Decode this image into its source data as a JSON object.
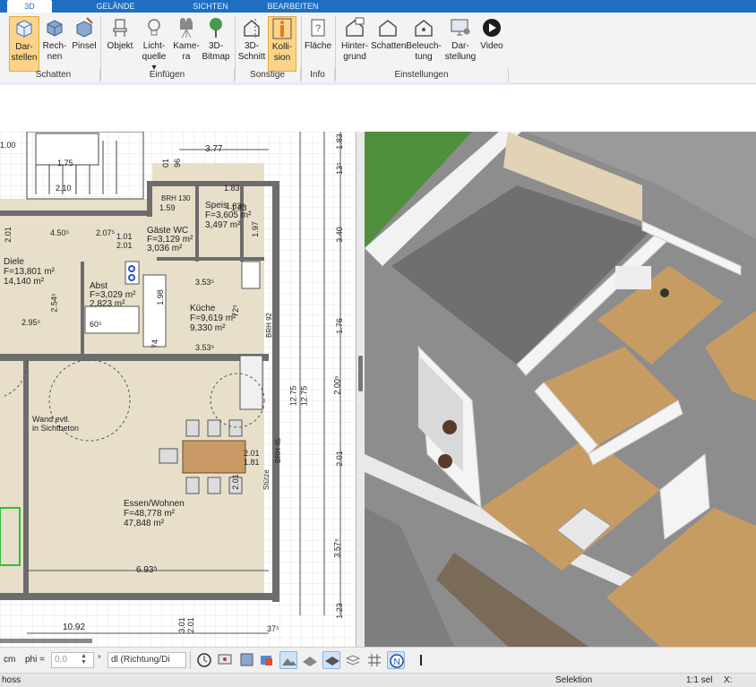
{
  "tabs": [
    {
      "label": "3D"
    },
    {
      "label": "GELÄNDE"
    },
    {
      "label": "SICHTEN"
    },
    {
      "label": "BEARBEITEN"
    }
  ],
  "ribbon": {
    "buttons": [
      {
        "line1": "Dar-",
        "line2": "stellen",
        "icon": "render-icon",
        "selected": true
      },
      {
        "line1": "Rech-",
        "line2": "nen",
        "icon": "calculate-icon",
        "selected": false
      },
      {
        "line1": "Pinsel",
        "line2": "",
        "icon": "brush-icon",
        "selected": false
      },
      {
        "line1": "Objekt",
        "line2": "",
        "icon": "chair-icon",
        "selected": false
      },
      {
        "line1": "Licht-",
        "line2": "quelle ▾",
        "icon": "lightbulb-icon",
        "selected": false
      },
      {
        "line1": "Kame-",
        "line2": "ra",
        "icon": "camera-icon",
        "selected": false
      },
      {
        "line1": "3D-",
        "line2": "Bitmap",
        "icon": "tree-icon",
        "selected": false
      },
      {
        "line1": "3D-",
        "line2": "Schnitt",
        "icon": "section-icon",
        "selected": false
      },
      {
        "line1": "Kolli-",
        "line2": "sion",
        "icon": "collision-person-icon",
        "selected": true
      },
      {
        "line1": "Fläche",
        "line2": "",
        "icon": "area-icon",
        "selected": false
      },
      {
        "line1": "Hinter-",
        "line2": "grund",
        "icon": "house-background-icon",
        "selected": false
      },
      {
        "line1": "Schatten",
        "line2": "",
        "icon": "house-shadow-icon",
        "selected": false
      },
      {
        "line1": "Beleuch-",
        "line2": "tung",
        "icon": "house-light-icon",
        "selected": false
      },
      {
        "line1": "Dar-",
        "line2": "stellung",
        "icon": "monitor-settings-icon",
        "selected": false
      },
      {
        "line1": "Video",
        "line2": "",
        "icon": "video-play-icon",
        "selected": false
      }
    ],
    "groups": [
      {
        "label": "Schatten"
      },
      {
        "label": "Einfügen"
      },
      {
        "label": "Sonstige"
      },
      {
        "label": "Info"
      },
      {
        "label": "Einstellungen"
      }
    ]
  },
  "plan": {
    "dims_top": [
      "3.77",
      "96",
      "01",
      "1.83",
      "1.83⁵",
      "1.75",
      "2.10",
      "1.00"
    ],
    "dims_right": [
      "1.83",
      "13⁵",
      "3.40",
      "1.76",
      "2.00⁵",
      "12.75",
      "12.75",
      "2.01",
      "3.57⁵",
      "1.23"
    ],
    "dims_bottom": [
      "10.92",
      "6.93⁵",
      "3.01",
      "2.01",
      "37⁵"
    ],
    "rooms": [
      {
        "name": "Diele",
        "line2": "F=13,801 m²",
        "line3": "14,140 m²"
      },
      {
        "name": "Abst",
        "line2": "F=3,029 m²",
        "line3": "2,823 m²"
      },
      {
        "name": "Gäste WC",
        "line2": "F=3,129 m²",
        "line3": "3,036 m²"
      },
      {
        "name": "Speis",
        "line2": "F=3,605 m²",
        "line3": "3,497 m²"
      },
      {
        "name": "Küche",
        "line2": "F=9,619 m²",
        "line3": "9,330 m²"
      },
      {
        "name": "Essen/Wohnen",
        "line2": "F=48,778 m²",
        "line3": "47,848 m²"
      }
    ],
    "notes": {
      "wall": "Wand evtl.",
      "wall2": "in Sichtbeton",
      "brh130": "BRH 130",
      "brh45": "BRH 45",
      "brh92": "BRH 92",
      "stuetze": "Stütze"
    },
    "misc_dims": [
      "4.50⁵",
      "2.95⁵",
      "2.54⁵",
      "2.07⁵",
      "1.01",
      "2.01",
      "60⁵",
      "1.98",
      "1.59",
      "72⁵",
      "3.53⁵",
      "3.53⁵",
      "74",
      "2.01",
      "1.81",
      "2.01",
      "1.83",
      "2.01",
      "1.97"
    ]
  },
  "toolbar": {
    "unit": "cm",
    "phi_label": "phi =",
    "phi_value": "0,0",
    "degree": "°",
    "dropdown": "dl (Richtung/Di",
    "icons": [
      "clock-icon",
      "monitor-icon",
      "render-settings-icon",
      "paint-icon",
      "mountain-icon",
      "texture-icon",
      "layer-icon",
      "stack-icon",
      "grid-icon",
      "north-icon",
      "more-icon"
    ]
  },
  "status": {
    "left": "hoss",
    "center": "Selektion",
    "scale": "1:1 sel",
    "x": "X:"
  }
}
